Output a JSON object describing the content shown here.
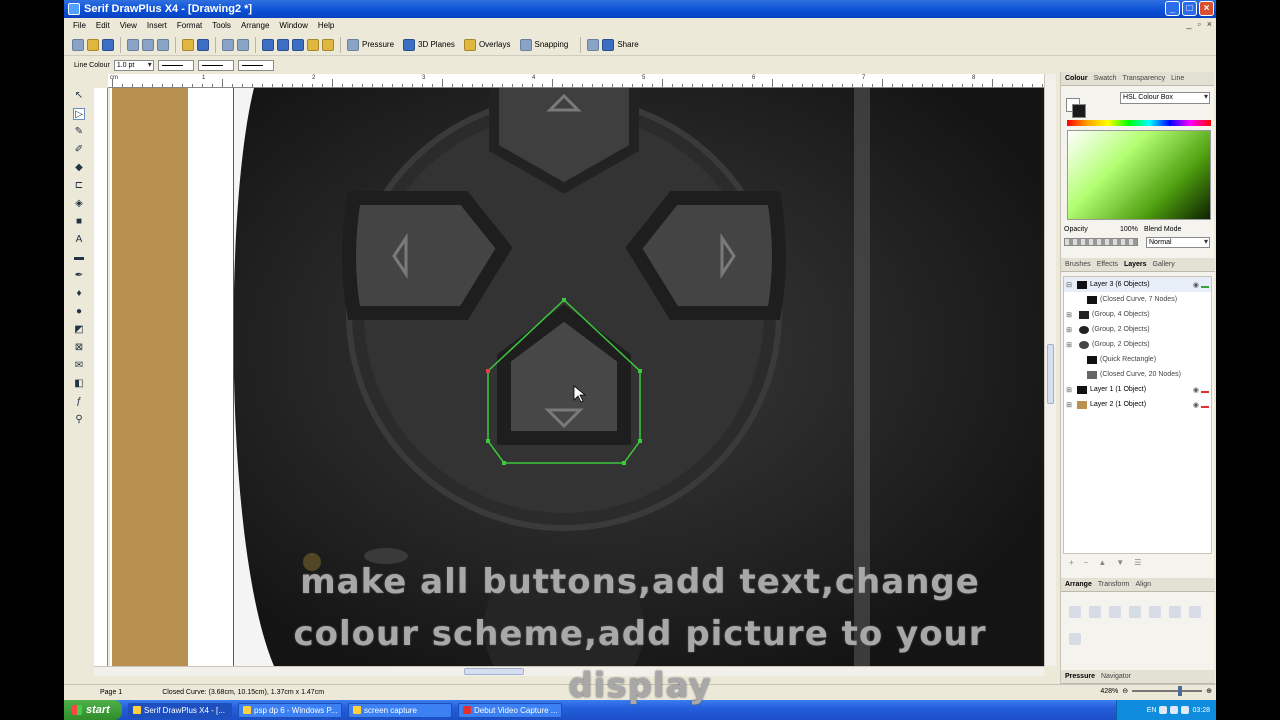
{
  "window": {
    "title": "Serif DrawPlus X4 - [Drawing2 *]",
    "mdi_controls": [
      "_",
      "▫",
      "×"
    ]
  },
  "menu": [
    "File",
    "Edit",
    "View",
    "Insert",
    "Format",
    "Tools",
    "Arrange",
    "Window",
    "Help"
  ],
  "toolbar": {
    "pressure": "Pressure",
    "planes": "3D Planes",
    "overlays": "Overlays",
    "snapping": "Snapping",
    "share": "Share"
  },
  "context_bar": {
    "line_colour_label": "Line Colour",
    "line_width": "1.0 pt"
  },
  "ruler": {
    "unit": "cm",
    "labels": [
      "1",
      "2",
      "3",
      "4",
      "5",
      "6",
      "7",
      "8"
    ]
  },
  "panel": {
    "color_tabs": [
      "Colour",
      "Swatch",
      "Transparency",
      "Line"
    ],
    "color_mode": "HSL Colour Box",
    "opacity_label": "Opacity",
    "opacity_value": "100%",
    "blend_label": "Blend Mode",
    "blend_value": "Normal",
    "layer_tabs": [
      "Brushes",
      "Effects",
      "Layers",
      "Gallery"
    ],
    "layers": [
      {
        "name": "Layer 3",
        "detail": "(6 Objects)",
        "swatch": "#3ca03c"
      },
      {
        "name": "(Closed Curve, 7 Nodes)",
        "detail": ""
      },
      {
        "name": "(Group, 4 Objects)",
        "detail": ""
      },
      {
        "name": "(Group, 2 Objects)",
        "detail": ""
      },
      {
        "name": "(Group, 2 Objects)",
        "detail": ""
      },
      {
        "name": "(Quick Rectangle)",
        "detail": ""
      },
      {
        "name": "(Closed Curve, 20 Nodes)",
        "detail": ""
      },
      {
        "name": "Layer 1",
        "detail": "(1 Object)",
        "swatch": "#e03030"
      },
      {
        "name": "Layer 2",
        "detail": "(1 Object)",
        "swatch": "#e03030"
      }
    ],
    "arrange_tabs": [
      "Arrange",
      "Transform",
      "Align"
    ],
    "bottom_tabs": [
      "Pressure",
      "Navigator"
    ]
  },
  "status": {
    "page": "Page 1",
    "selection": "Closed Curve: (3.68cm, 10.15cm), 1.37cm x 1.47cm",
    "zoom": "428%"
  },
  "taskbar": {
    "start": "start",
    "tasks": [
      "Serif DrawPlus X4 - [...",
      "psp dp 6 - Windows P...",
      "screen capture",
      "Debut Video Capture ..."
    ],
    "lang": "EN",
    "clock": "03:28"
  },
  "caption": {
    "line1": "make all buttons,add text,change",
    "line2": "colour scheme,add picture to your",
    "line3": "display"
  },
  "colors": {
    "selection_curve": "#3cc83c",
    "tan_block": "#b8904f"
  }
}
